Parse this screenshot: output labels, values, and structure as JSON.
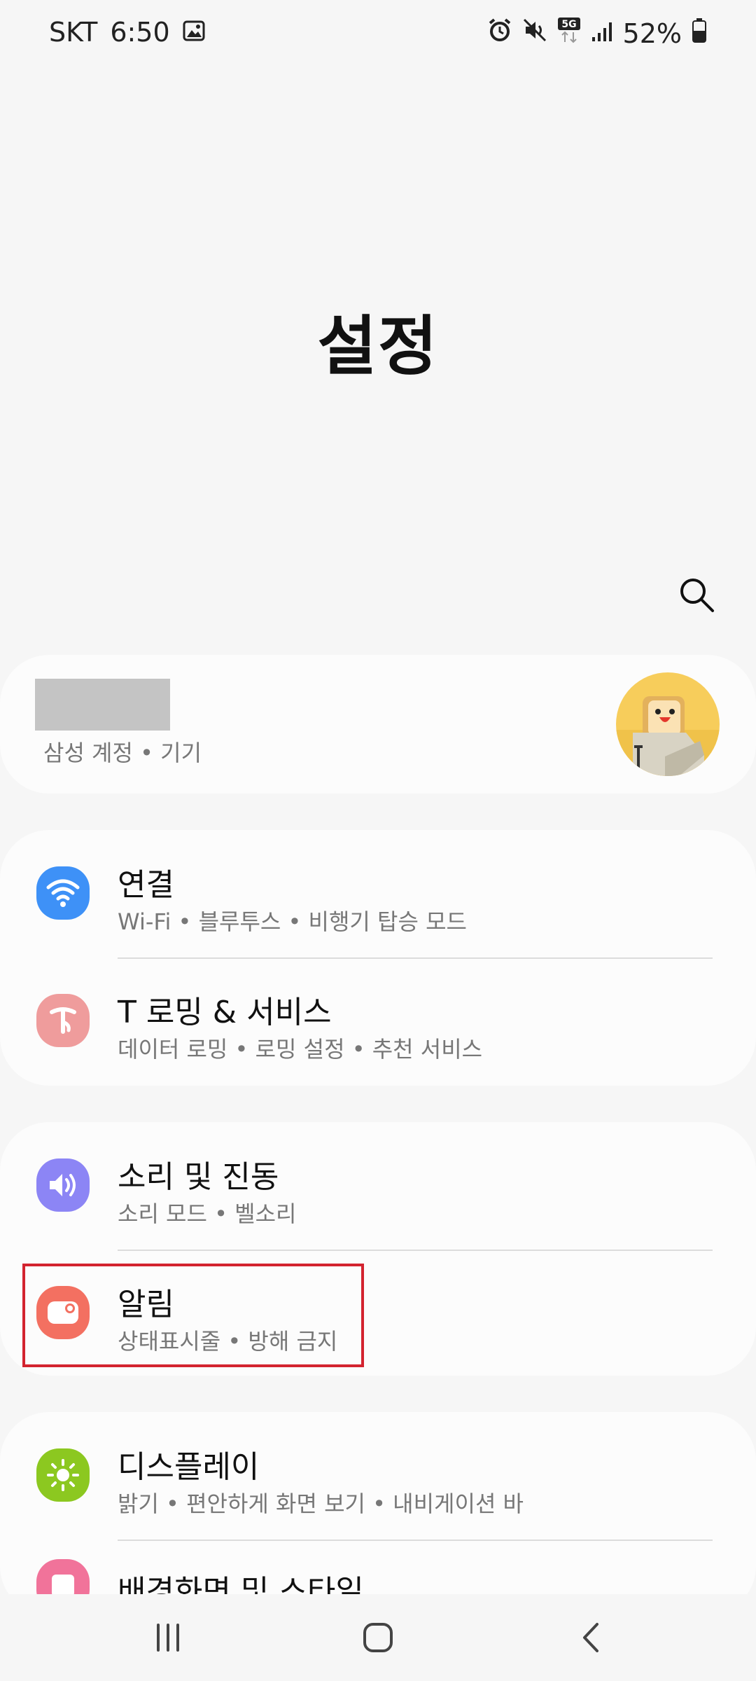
{
  "status": {
    "carrier": "SKT",
    "time": "6:50",
    "battery": "52%",
    "network": "5G"
  },
  "title": "설정",
  "account": {
    "subtitle": "삼성 계정 • 기기"
  },
  "groups": [
    {
      "items": [
        {
          "title": "연결",
          "subtitle": "Wi-Fi • 블루투스 • 비행기 탑승 모드",
          "icon": "wifi-icon",
          "color": "#3e91f7"
        },
        {
          "title": "T 로밍 & 서비스",
          "subtitle": "데이터 로밍 • 로밍 설정 • 추천 서비스",
          "icon": "t-service-icon",
          "color": "#ef9c9c"
        }
      ]
    },
    {
      "items": [
        {
          "title": "소리 및 진동",
          "subtitle": "소리 모드 • 벨소리",
          "icon": "volume-icon",
          "color": "#8c85f5"
        },
        {
          "title": "알림",
          "subtitle": "상태표시줄 • 방해 금지",
          "icon": "notification-icon",
          "color": "#f37061"
        }
      ]
    },
    {
      "items": [
        {
          "title": "디스플레이",
          "subtitle": "밝기 • 편안하게 화면 보기 • 내비게이션 바",
          "icon": "sun-icon",
          "color": "#8cc820"
        },
        {
          "title": "배경화면 및 스타일",
          "subtitle": "",
          "icon": "wallpaper-icon",
          "color": "#f1739a"
        }
      ]
    }
  ]
}
